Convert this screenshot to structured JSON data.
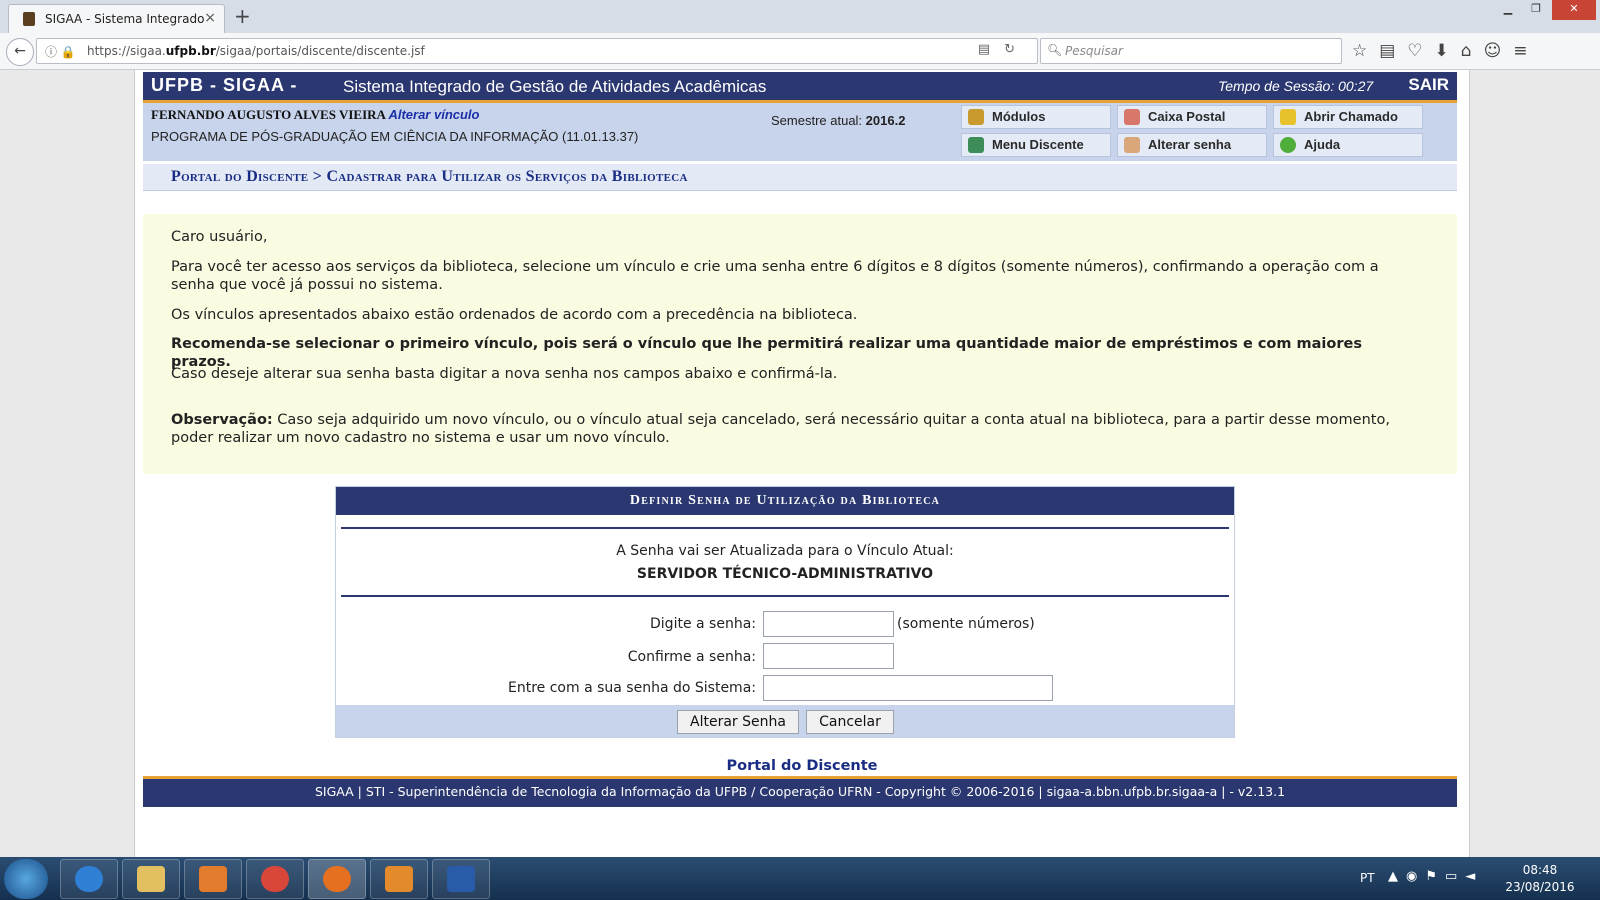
{
  "browser": {
    "tab_title": "SIGAA - Sistema Integrado ...",
    "tab_close": "×",
    "new_tab": "+",
    "url_prefix": "https://sigaa.",
    "url_domain": "ufpb.br",
    "url_suffix": "/sigaa/portais/discente/discente.jsf",
    "search_placeholder": "Pesquisar"
  },
  "header": {
    "brand": "UFPB - SIGAA -",
    "system_name": "Sistema Integrado de Gestão de Atividades Acadêmicas",
    "session_label": "Tempo de Sessão: 00:27",
    "logout": "SAIR"
  },
  "user": {
    "name": "FERNANDO AUGUSTO ALVES VIEIRA",
    "change_link": "Alterar vínculo",
    "program": "PROGRAMA DE PÓS-GRADUAÇÃO EM CIÊNCIA DA INFORMAÇÃO (11.01.13.37)",
    "semester_label": "Semestre atual:",
    "semester_value": "2016.2"
  },
  "menu": {
    "modulos": "Módulos",
    "caixa_postal": "Caixa Postal",
    "abrir_chamado": "Abrir Chamado",
    "menu_discente": "Menu Discente",
    "alterar_senha": "Alterar senha",
    "ajuda": "Ajuda"
  },
  "breadcrumb": "Portal do Discente > Cadastrar para Utilizar os Serviços da Biblioteca",
  "notice": {
    "greeting": "Caro usuário,",
    "p1": "Para você ter acesso aos serviços da biblioteca, selecione um vínculo e crie uma senha entre 6 dígitos e 8 dígitos (somente números), confirmando a operação com a senha que você já possui no sistema.",
    "p2": "Os vínculos apresentados abaixo estão ordenados de acordo com a precedência na biblioteca.",
    "p3": "Recomenda-se selecionar o primeiro vínculo, pois será o vínculo que lhe permitirá realizar uma quantidade maior de empréstimos e com maiores prazos.",
    "p4": "Caso deseje alterar sua senha basta digitar a nova senha nos campos abaixo e confirmá-la.",
    "obs_label": "Observação:",
    "obs_text": " Caso seja adquirido um novo vínculo, ou o vínculo atual seja cancelado, será necessário quitar a conta atual na biblioteca, para a partir desse momento, poder realizar um novo cadastro no sistema e usar um novo vínculo."
  },
  "form": {
    "title": "Definir Senha de Utilização da Biblioteca",
    "update_info": "A Senha vai ser Atualizada para o Vínculo Atual:",
    "vinculo": "SERVIDOR TÉCNICO-ADMINISTRATIVO",
    "password_label": "Digite a senha:",
    "password_hint": "(somente números)",
    "confirm_label": "Confirme a senha:",
    "system_password_label": "Entre com a sua senha do Sistema:",
    "password_value": "",
    "confirm_value": "",
    "system_password_value": "",
    "submit": "Alterar Senha",
    "cancel": "Cancelar"
  },
  "portal_link": "Portal do Discente",
  "footer": "SIGAA | STI - Superintendência de Tecnologia da Informação da UFPB / Cooperação UFRN - Copyright © 2006-2016 | sigaa-a.bbn.ufpb.br.sigaa-a | - v2.13.1",
  "taskbar": {
    "language": "PT",
    "time": "08:48",
    "date": "23/08/2016"
  },
  "colors": {
    "header_bg": "#2b3770",
    "accent_orange": "#e8a234",
    "info_bg": "#c8d4ec",
    "notice_bg": "#fbfbe2",
    "link_blue": "#1a2d85"
  }
}
